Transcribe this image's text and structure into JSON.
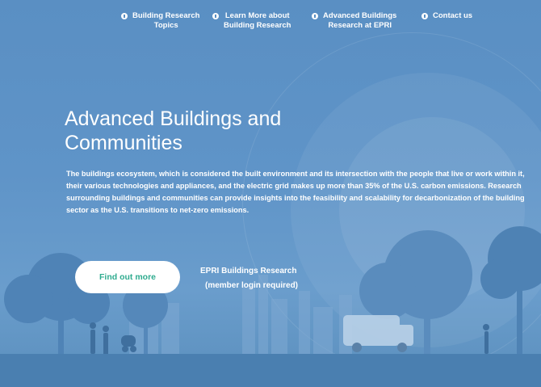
{
  "nav": {
    "items": [
      {
        "label": "Building Research\nTopics"
      },
      {
        "label": "Learn More about\nBuilding Research"
      },
      {
        "label": "Advanced Buildings\nResearch at EPRI"
      },
      {
        "label": "Contact us"
      }
    ]
  },
  "hero": {
    "title": "Advanced Buildings and Communities",
    "description": "The buildings ecosystem, which is considered the built environment and its intersection with the people that live or work within it, their various technologies and appliances, and the electric grid makes up more than 35% of the U.S. carbon emissions. Research surrounding buildings and communities can provide insights into the feasibility and scalability for decarbonization of the building sector as the U.S. transitions to net-zero emissions.",
    "cta_label": "Find out more",
    "member_link_line1": "EPRI Buildings Research",
    "member_link_line2": "(member login required)"
  },
  "colors": {
    "background": "#5a8fc3",
    "button_text": "#2fab8f",
    "text": "#ffffff"
  }
}
